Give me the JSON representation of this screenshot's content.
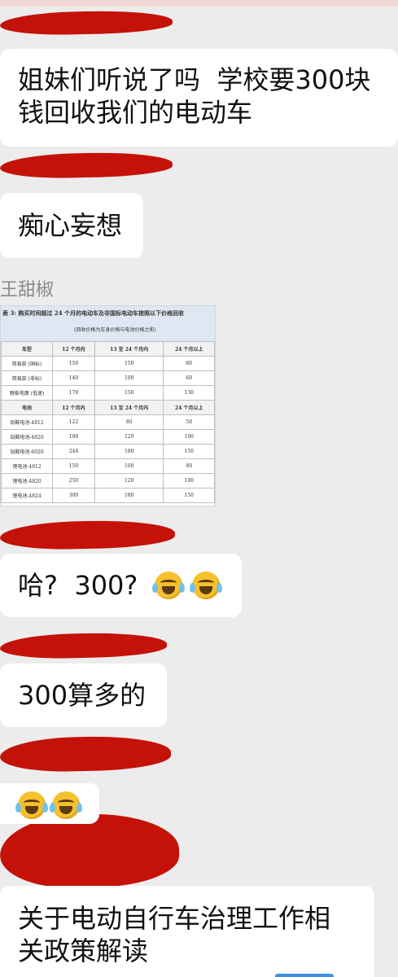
{
  "messages": [
    {
      "text": "姐妹们听说了吗  学校要300块\n钱回收我们的电动车"
    },
    {
      "text": "痴心妄想"
    },
    {
      "text": "哈?  300?"
    },
    {
      "text": "300算多的"
    },
    {
      "text": "关于电动自行车治理工作相\n关政策解读"
    }
  ],
  "sender_name": "王甜椒",
  "icons": {
    "laugh_cry": "laugh-cry-emoji"
  },
  "colors": {
    "redaction": "#c41208",
    "bubble": "#ffffff",
    "background": "#ececec",
    "table_header": "#dfe7f2"
  },
  "price_table": {
    "caption": "表 3:  购买时间超过 24 个月的电动车及非国标电动车按照以下价格回收",
    "note": "(回收价格为车身价格与电池价格之和)",
    "vehicle_headers": [
      "车型",
      "12 个月内",
      "13 至 24 个月内",
      "24 个月以上"
    ],
    "vehicle_rows": [
      [
        "简易款 (国标)",
        "150",
        "150",
        "80"
      ],
      [
        "简易款 (非标)",
        "140",
        "100",
        "60"
      ],
      [
        "踏板电摩 (低速)",
        "170",
        "150",
        "130"
      ]
    ],
    "battery_headers": [
      "电池",
      "12 个月内",
      "13 至 24 个月内",
      "24 个月以上"
    ],
    "battery_rows": [
      [
        "铅酸电池-4812",
        "122",
        "80",
        "50"
      ],
      [
        "铅酸电池-4820",
        "198",
        "120",
        "100"
      ],
      [
        "铅酸电池-6020",
        "248",
        "180",
        "150"
      ],
      [
        "锂电池-4812",
        "150",
        "100",
        "80"
      ],
      [
        "锂电池-4820",
        "250",
        "120",
        "100"
      ],
      [
        "锂电池-4824",
        "300",
        "180",
        "150"
      ]
    ]
  }
}
